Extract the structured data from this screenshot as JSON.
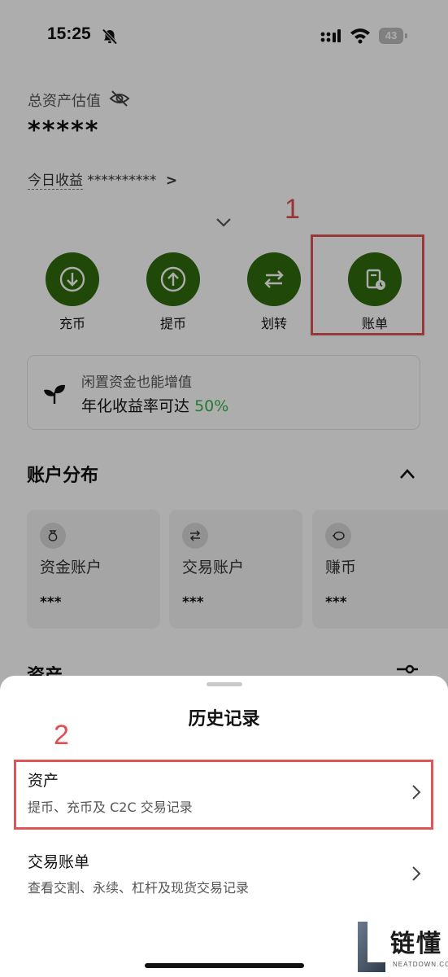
{
  "status_bar": {
    "time": "15:25",
    "battery": "43"
  },
  "overview": {
    "total_assets_label": "总资产估值",
    "total_assets_value": "*****",
    "today_profit_label": "今日收益",
    "today_profit_value": "**********",
    "chevron": ">"
  },
  "annotations": {
    "step1": "1",
    "step2": "2",
    "accent_color": "#e05555"
  },
  "actions": [
    {
      "label": "充币",
      "icon": "deposit-icon"
    },
    {
      "label": "提币",
      "icon": "withdraw-icon"
    },
    {
      "label": "划转",
      "icon": "transfer-icon"
    },
    {
      "label": "账单",
      "icon": "bill-icon"
    }
  ],
  "promo": {
    "line1": "闲置资金也能增值",
    "line2_prefix": "年化收益率可达",
    "rate": "50%"
  },
  "account_distribution": {
    "title": "账户分布",
    "accounts": [
      {
        "name": "资金账户",
        "value": "***"
      },
      {
        "name": "交易账户",
        "value": "***"
      },
      {
        "name": "赚币",
        "value": "***"
      }
    ]
  },
  "assets_section_title": "资产",
  "sheet": {
    "title": "历史记录",
    "items": [
      {
        "title": "资产",
        "subtitle": "提币、充币及 C2C 交易记录"
      },
      {
        "title": "交易账单",
        "subtitle": "查看交割、永续、杠杆及现货交易记录"
      }
    ]
  },
  "watermark": {
    "cn": "链懂",
    "en": "NEATDOWN.COM"
  },
  "colors": {
    "brand_green": "#2e6b0e",
    "positive": "#36b34a"
  }
}
